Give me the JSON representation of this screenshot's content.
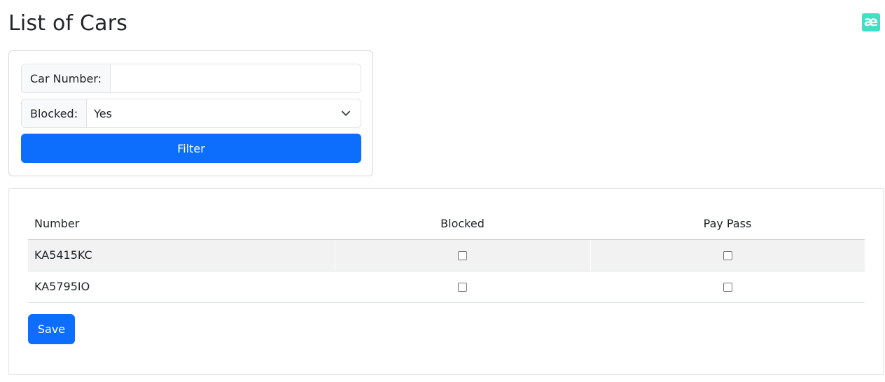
{
  "page": {
    "title": "List of Cars",
    "logo_text": "æ",
    "logo_color": "#3fe0c5"
  },
  "filter": {
    "car_number_label": "Car Number:",
    "car_number_value": "",
    "blocked_label": "Blocked:",
    "blocked_selected": "Yes",
    "filter_button": "Filter"
  },
  "table": {
    "headers": [
      "Number",
      "Blocked",
      "Pay Pass"
    ],
    "rows": [
      {
        "number": "KA5415KC",
        "blocked": false,
        "pay_pass": false
      },
      {
        "number": "KA5795IO",
        "blocked": false,
        "pay_pass": false
      }
    ],
    "save_button": "Save"
  },
  "colors": {
    "primary": "#0d6efd",
    "stripe": "#f2f2f2"
  }
}
